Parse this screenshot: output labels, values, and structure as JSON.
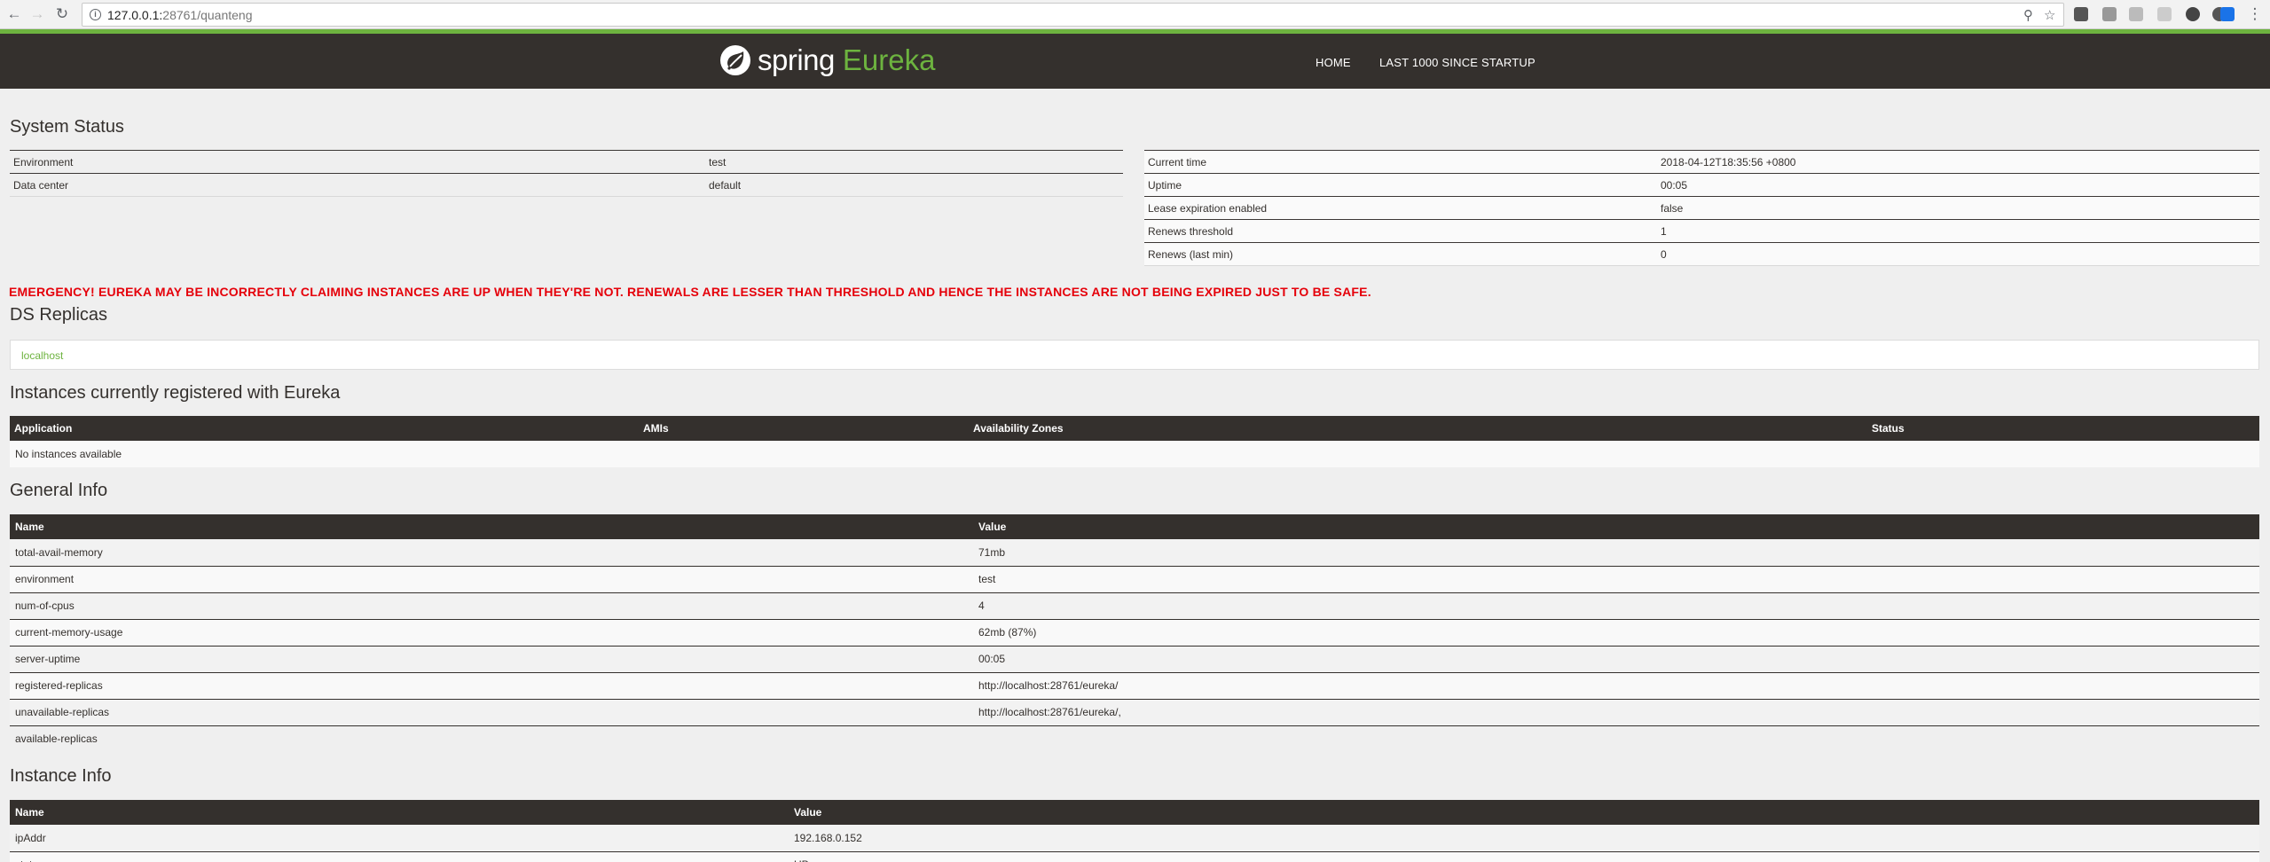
{
  "browser": {
    "url_host": "127.0.0.1:",
    "url_path": "28761/quanteng"
  },
  "header": {
    "logo_spring": "spring",
    "logo_eureka": "Eureka",
    "nav": [
      "HOME",
      "LAST 1000 SINCE STARTUP"
    ]
  },
  "system_status": {
    "title": "System Status",
    "left": [
      {
        "label": "Environment",
        "value": "test"
      },
      {
        "label": "Data center",
        "value": "default"
      }
    ],
    "right": [
      {
        "label": "Current time",
        "value": "2018-04-12T18:35:56 +0800"
      },
      {
        "label": "Uptime",
        "value": "00:05"
      },
      {
        "label": "Lease expiration enabled",
        "value": "false"
      },
      {
        "label": "Renews threshold",
        "value": "1"
      },
      {
        "label": "Renews (last min)",
        "value": "0"
      }
    ]
  },
  "emergency": "EMERGENCY! EUREKA MAY BE INCORRECTLY CLAIMING INSTANCES ARE UP WHEN THEY'RE NOT. RENEWALS ARE LESSER THAN THRESHOLD AND HENCE THE INSTANCES ARE NOT BEING EXPIRED JUST TO BE SAFE.",
  "ds_replicas": {
    "title": "DS Replicas",
    "items": [
      "localhost"
    ]
  },
  "instances": {
    "title": "Instances currently registered with Eureka",
    "headers": [
      "Application",
      "AMIs",
      "Availability Zones",
      "Status"
    ],
    "empty": "No instances available"
  },
  "general_info": {
    "title": "General Info",
    "headers": [
      "Name",
      "Value"
    ],
    "rows": [
      {
        "name": "total-avail-memory",
        "value": "71mb"
      },
      {
        "name": "environment",
        "value": "test"
      },
      {
        "name": "num-of-cpus",
        "value": "4"
      },
      {
        "name": "current-memory-usage",
        "value": "62mb (87%)"
      },
      {
        "name": "server-uptime",
        "value": "00:05"
      },
      {
        "name": "registered-replicas",
        "value": "http://localhost:28761/eureka/"
      },
      {
        "name": "unavailable-replicas",
        "value": "http://localhost:28761/eureka/,"
      },
      {
        "name": "available-replicas",
        "value": ""
      }
    ]
  },
  "instance_info": {
    "title": "Instance Info",
    "headers": [
      "Name",
      "Value"
    ],
    "rows": [
      {
        "name": "ipAddr",
        "value": "192.168.0.152"
      },
      {
        "name": "status",
        "value": "UP"
      }
    ]
  },
  "colors": {
    "brand_green": "#6db33f",
    "header_dark": "#34302d",
    "emergency_red": "#e5000a"
  }
}
